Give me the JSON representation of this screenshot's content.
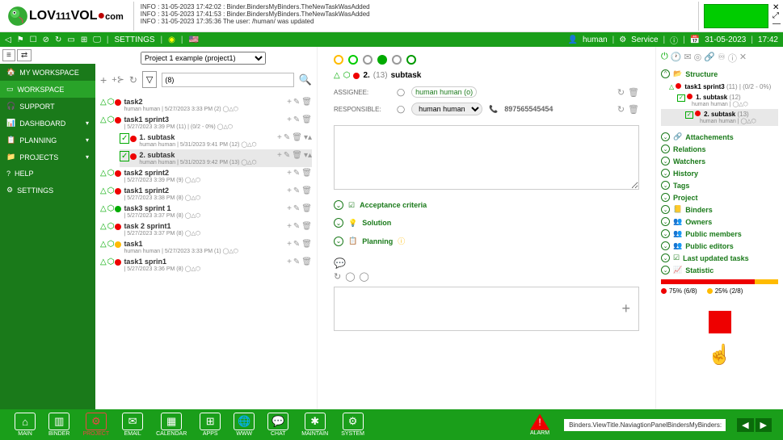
{
  "logo": {
    "text_parts": [
      "LOV",
      "111",
      "VOL",
      ".com"
    ]
  },
  "logs": [
    "INFO : 31-05-2023 17:42:02 : Binder.BindersMyBinders.TheNewTaskWasAdded",
    "INFO : 31-05-2023 17:41:53 : Binder.BindersMyBinders.TheNewTaskWasAdded",
    "INFO : 31-05-2023 17:35:36 The user: /human/ was updated"
  ],
  "topbar": {
    "settings": "SETTINGS",
    "user": "human",
    "service": "Service",
    "date": "31-05-2023",
    "time": "17:42"
  },
  "sidebar": {
    "items": [
      {
        "icon": "🏠",
        "label": "MY WORKSPACE"
      },
      {
        "icon": "▭",
        "label": "WORKSPACE",
        "active": true
      },
      {
        "icon": "🎧",
        "label": "SUPPORT"
      },
      {
        "icon": "📊",
        "label": "DASHBOARD",
        "chev": true
      },
      {
        "icon": "📋",
        "label": "PLANNING",
        "chev": true
      },
      {
        "icon": "📁",
        "label": "PROJECTS",
        "chev": true
      },
      {
        "icon": "?",
        "label": "HELP"
      },
      {
        "icon": "⚙",
        "label": "SETTINGS"
      }
    ]
  },
  "project_select": "Project 1 example (project1)",
  "filter_value": "(8)",
  "tasks": [
    {
      "title": "task2",
      "meta": "human human | 5/27/2023 3:33 PM (2) ◯△⬡",
      "dot": "red",
      "indent": 0
    },
    {
      "title": "task1 sprint3",
      "meta": "| 5/27/2023 3:39 PM (11) | (0/2 - 0%) ◯△⬡",
      "dot": "red",
      "indent": 0,
      "expanded": true
    },
    {
      "title": "1. subtask",
      "meta": "human human | 5/31/2023 9:41 PM (12) ◯△⬡",
      "dot": "red",
      "indent": 1,
      "check": true
    },
    {
      "title": "2. subtask",
      "meta": "human human | 5/31/2023 9:42 PM (13) ◯△⬡",
      "dot": "red",
      "indent": 1,
      "check": true,
      "selected": true
    },
    {
      "title": "task2 sprint2",
      "meta": "| 5/27/2023 3:39 PM (9) ◯△⬡",
      "dot": "red",
      "indent": 0
    },
    {
      "title": "task1 sprint2",
      "meta": "| 5/27/2023 3:38 PM (8) ◯△⬡",
      "dot": "red",
      "indent": 0
    },
    {
      "title": "task3 sprint 1",
      "meta": "| 5/27/2023 3:37 PM (8) ◯△⬡",
      "dot": "green",
      "indent": 0
    },
    {
      "title": "task 2 sprint1",
      "meta": "| 5/27/2023 3:37 PM (8) ◯△⬡",
      "dot": "red",
      "indent": 0
    },
    {
      "title": "task1",
      "meta": "human human | 5/27/2023 3:33 PM (1) ◯△⬡",
      "dot": "yellow",
      "indent": 0
    },
    {
      "title": "task1 sprin1",
      "meta": "| 5/27/2023 3:36 PM (8) ◯△⬡",
      "dot": "red",
      "indent": 0
    }
  ],
  "detail": {
    "number": "2.",
    "id": "(13)",
    "title": "subtask",
    "assignee_label": "ASSIGNEE:",
    "assignee": "human human  (o)",
    "responsible_label": "RESPONSIBLE:",
    "responsible": "human human",
    "phone": "897565545454",
    "sections": {
      "acc": "Acceptance criteria",
      "sol": "Solution",
      "plan": "Planning"
    }
  },
  "right": {
    "structure": "Structure",
    "tree": [
      {
        "label": "task1 sprint3",
        "suffix": "(11) | (0/2 - 0%)",
        "dot": "red"
      },
      {
        "label": "1. subtask",
        "suffix": "(12)",
        "meta": "human human | ◯△⬡",
        "dot": "red",
        "check": true
      },
      {
        "label": "2. subtask",
        "suffix": "(13)",
        "meta": "human human | ◯△⬡",
        "dot": "red",
        "check": true,
        "selected": true
      }
    ],
    "sections": [
      "Attachements",
      "Relations",
      "Watchers",
      "History",
      "Tags",
      "Project",
      "Binders",
      "Owners",
      "Public members",
      "Public editors",
      "Last updated tasks",
      "Statistic"
    ],
    "stat": {
      "left": "75% (6/8)",
      "right": "25% (2/8)"
    }
  },
  "bottom": {
    "items": [
      {
        "icon": "⌂",
        "label": "MAIN"
      },
      {
        "icon": "▥",
        "label": "BINDER"
      },
      {
        "icon": "⚙",
        "label": "PROJECT",
        "red": true
      },
      {
        "icon": "✉",
        "label": "EMAIL"
      },
      {
        "icon": "▦",
        "label": "CALENDAR"
      },
      {
        "icon": "⊞",
        "label": "APPS"
      },
      {
        "icon": "🌐",
        "label": "WWW"
      },
      {
        "icon": "💬",
        "label": "CHAT"
      },
      {
        "icon": "✱",
        "label": "MAINTAIN"
      },
      {
        "icon": "⚙",
        "label": "SYSTEM"
      }
    ],
    "alarm": "ALARM",
    "path": "Binders.ViewTitle.NaviagtionPanelBindersMyBinders:"
  }
}
